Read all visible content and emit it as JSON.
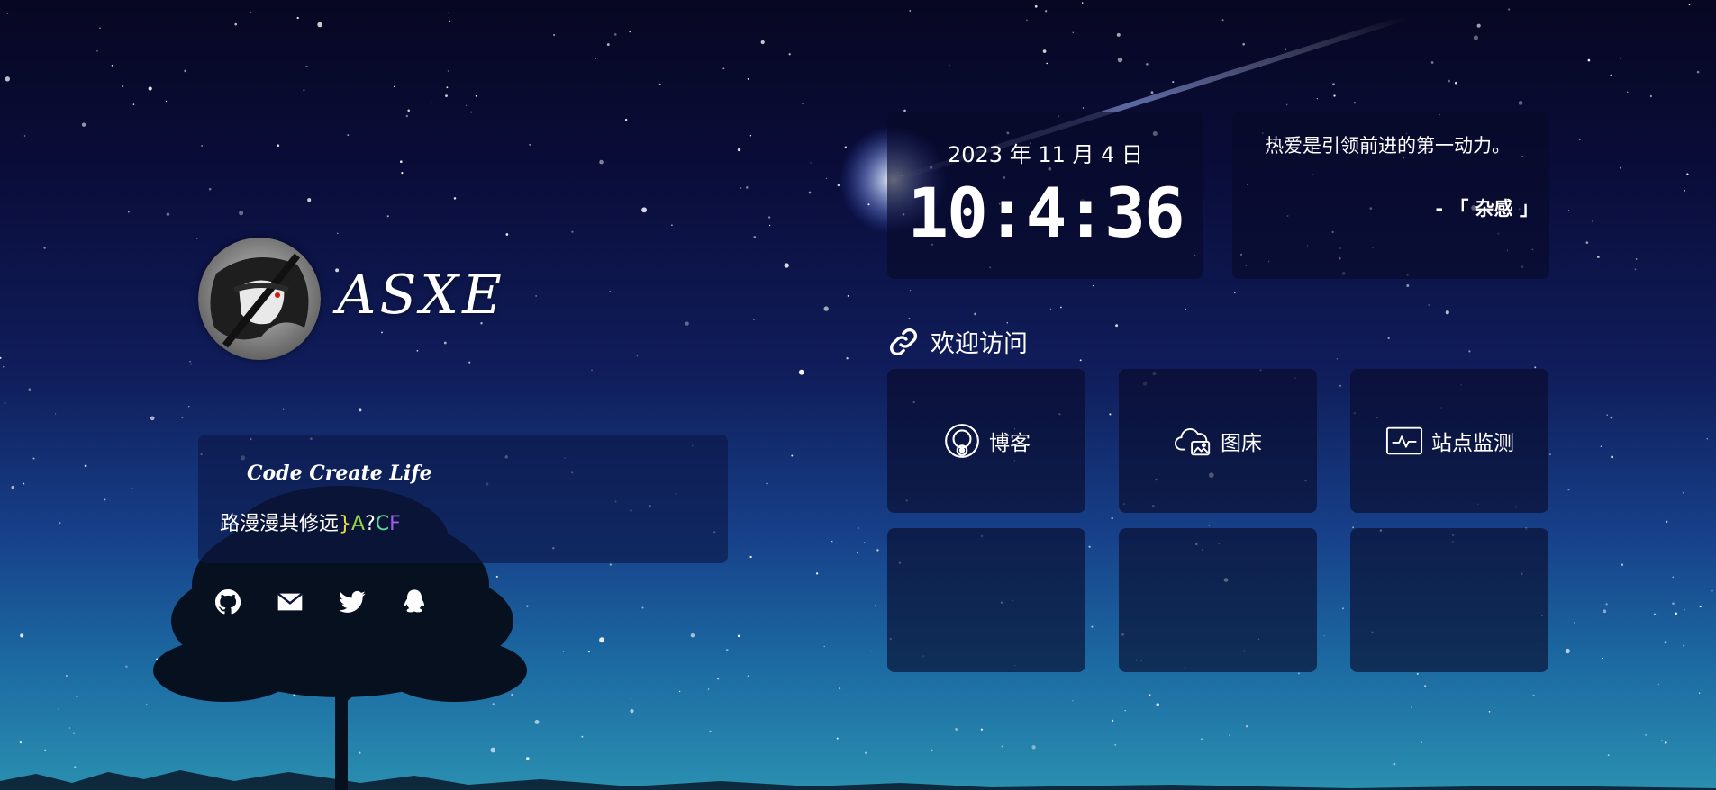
{
  "profile": {
    "name": "ASXE",
    "motto_title": "Code Create Life",
    "motto_text": "路漫漫其修远",
    "motto_glitch": [
      "}",
      "A",
      "?",
      "C",
      "F"
    ]
  },
  "socials": [
    {
      "name": "github-icon",
      "label": "GitHub"
    },
    {
      "name": "mail-icon",
      "label": "Email"
    },
    {
      "name": "twitter-icon",
      "label": "Twitter"
    },
    {
      "name": "qq-icon",
      "label": "QQ"
    }
  ],
  "clock": {
    "date": "2023 年 11 月 4 日",
    "time": "10:4:36"
  },
  "quote": {
    "text": "热爱是引领前进的第一动力。",
    "source": "- 「 杂感 」"
  },
  "links": {
    "heading": "欢迎访问",
    "heading_icon": "link-icon",
    "items": [
      {
        "label": "博客",
        "icon": "blog-icon"
      },
      {
        "label": "图床",
        "icon": "cloud-image-icon"
      },
      {
        "label": "站点监测",
        "icon": "monitor-icon"
      }
    ]
  },
  "colors": {
    "glitch_1": "#ecd94a",
    "glitch_2": "#9ad545",
    "glitch_3": "#64d89a",
    "glitch_4": "#9a5fe8"
  }
}
